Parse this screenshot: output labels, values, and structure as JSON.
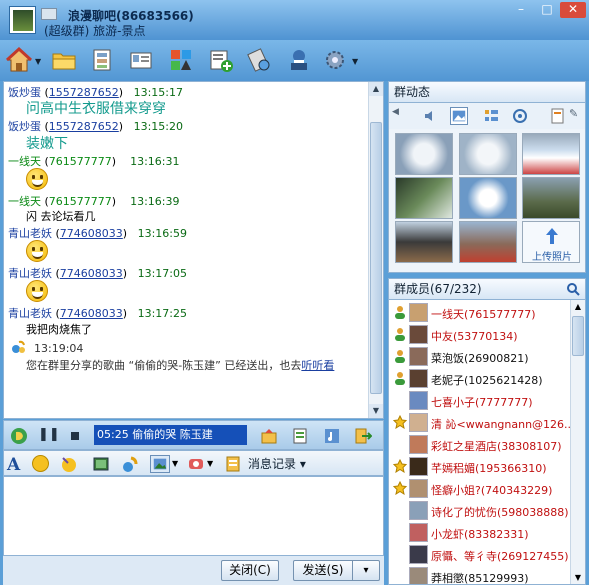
{
  "window": {
    "title": "浪漫聊吧(86683566)",
    "subtitle": "(超级群) 旅游-景点",
    "min": "–",
    "max": "□",
    "close": "✕"
  },
  "toolbar": {
    "icons": [
      "home-icon",
      "folder-icon",
      "album-icon",
      "card-icon",
      "app-icon",
      "add-member-icon",
      "settings-tools-icon",
      "profile-icon",
      "gear-icon"
    ]
  },
  "chat": {
    "messages": [
      {
        "nick": "饭炒蛋",
        "qq": "1557287652",
        "time": "13:15:17",
        "text": "问高中生衣服借来穿穿",
        "style": "big"
      },
      {
        "nick": "饭炒蛋",
        "qq": "1557287652",
        "time": "13:15:20",
        "text": "装嫩下",
        "style": "big"
      },
      {
        "nick": "一线天",
        "qq": "761577777",
        "time": "13:16:31",
        "text": "",
        "style": "smiley"
      },
      {
        "nick": "一线天",
        "qq": "761577777",
        "time": "13:16:39",
        "text": "闪     去论坛看几",
        "style": "normal"
      },
      {
        "nick": "青山老妖",
        "qq": "774608033",
        "time": "13:16:59",
        "text": "",
        "style": "smiley"
      },
      {
        "nick": "青山老妖",
        "qq": "774608033",
        "time": "13:17:05",
        "text": "",
        "style": "smiley"
      },
      {
        "nick": "青山老妖",
        "qq": "774608033",
        "time": "13:17:25",
        "text": "我把肉烧焦了",
        "style": "normal"
      }
    ],
    "system": {
      "time": "13:19:04",
      "text_before": "您在群里分享的歌曲 “偷偷的哭-陈玉建” 已经送出，也去",
      "link": "听听看"
    }
  },
  "music": {
    "song": "05:25 偷偷的哭   陈玉建"
  },
  "format": {
    "record_label": "消息记录",
    "record_arrow": "▾"
  },
  "buttons": {
    "close": "关闭(C)",
    "send": "发送(S)",
    "send_arrow": "▾"
  },
  "group_dynamic": {
    "title": "群动态",
    "upload_label": "上传照片"
  },
  "members": {
    "title": "群成员(67/232)",
    "list": [
      {
        "name": "一线天(761577777)",
        "color": "red"
      },
      {
        "name": "中友(53770134)",
        "color": "red"
      },
      {
        "name": "菜泡饭(26900821)",
        "color": "black"
      },
      {
        "name": "老妮子(1025621428)",
        "color": "black"
      },
      {
        "name": "七喜小子(7777777)",
        "color": "red"
      },
      {
        "name": "清 訫<wwangnann@126...",
        "color": "red"
      },
      {
        "name": "彩虹之星酒店(38308107)",
        "color": "red"
      },
      {
        "name": "芊嫣稆媚(195366310)",
        "color": "red"
      },
      {
        "name": "怪癖小姐?(740343229)",
        "color": "red"
      },
      {
        "name": "诗化了的忧伤(598038888)",
        "color": "red"
      },
      {
        "name": "小龙虾(83382331)",
        "color": "red"
      },
      {
        "name": "原懾、等彳寺(269127455)",
        "color": "red"
      },
      {
        "name": "莽相懲(85129993)",
        "color": "black"
      }
    ]
  }
}
